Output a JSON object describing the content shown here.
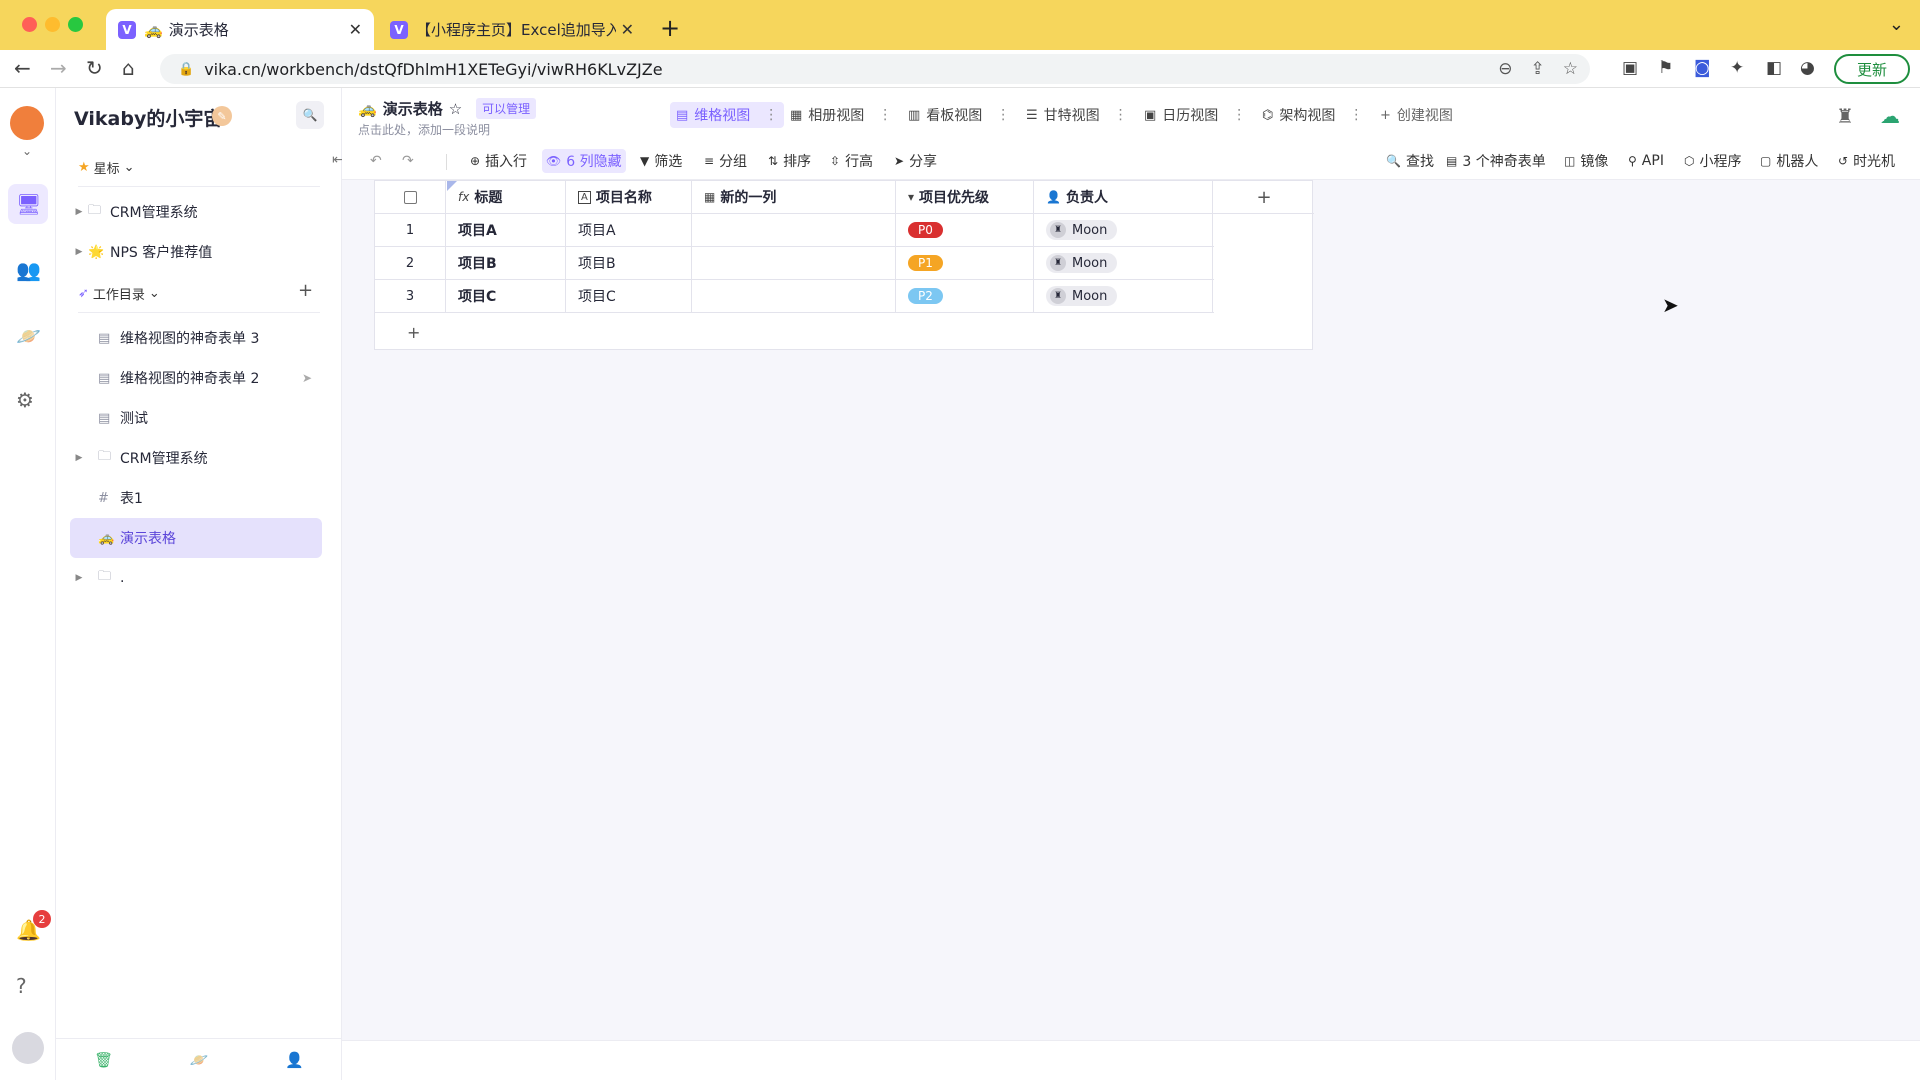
{
  "browser": {
    "tabs": [
      {
        "favicon": "V",
        "emoji": "🚕",
        "title": "演示表格",
        "active": true
      },
      {
        "favicon": "V",
        "title": "【小程序主页】Excel追加导入 -",
        "active": false
      }
    ],
    "url": "vika.cn/workbench/dstQfDhlmH1XETeGyi/viwRH6KLvZJZe",
    "update_label": "更新"
  },
  "space": {
    "name": "Vikaby的小宇宙",
    "starred_label": "星标",
    "starred_items": [
      {
        "label": "CRM管理系统",
        "icon": "folder-icon",
        "emoji": ""
      },
      {
        "label": "NPS 客户推荐值",
        "icon": "star-emoji-icon",
        "emoji": "🌟"
      }
    ],
    "workdir_label": "工作目录",
    "tree": [
      {
        "label": "维格视图的神奇表单 3",
        "icon": "form-icon",
        "has_arrow": false,
        "active": false,
        "send": false
      },
      {
        "label": "维格视图的神奇表单 2",
        "icon": "form-icon",
        "has_arrow": false,
        "active": false,
        "send": true
      },
      {
        "label": "测试",
        "icon": "form-icon",
        "has_arrow": false,
        "active": false,
        "send": false
      },
      {
        "label": "CRM管理系统",
        "icon": "folder-icon",
        "has_arrow": true,
        "active": false,
        "send": false
      },
      {
        "label": "表1",
        "icon": "datasheet-icon",
        "has_arrow": false,
        "active": false,
        "send": false
      },
      {
        "label": "演示表格",
        "icon": "taxi-emoji-icon",
        "has_arrow": false,
        "active": true,
        "send": false
      },
      {
        "label": ".",
        "icon": "folder-icon",
        "has_arrow": true,
        "active": false,
        "send": false
      }
    ],
    "notification_count": "2"
  },
  "datasheet": {
    "title": "演示表格",
    "permission": "可以管理",
    "description": "点击此处，添加一段说明",
    "views": [
      {
        "label": "维格视图",
        "icon": "grid-view-icon",
        "active": true
      },
      {
        "label": "相册视图",
        "icon": "gallery-view-icon",
        "active": false
      },
      {
        "label": "看板视图",
        "icon": "kanban-view-icon",
        "active": false
      },
      {
        "label": "甘特视图",
        "icon": "gantt-view-icon",
        "active": false
      },
      {
        "label": "日历视图",
        "icon": "calendar-view-icon",
        "active": false
      },
      {
        "label": "架构视图",
        "icon": "architecture-view-icon",
        "active": false
      }
    ],
    "create_view_label": "创建视图"
  },
  "toolbar": {
    "insert_row": "插入行",
    "hidden_cols": "6 列隐藏",
    "filter": "筛选",
    "group": "分组",
    "sort": "排序",
    "row_height": "行高",
    "share": "分享",
    "find": "查找",
    "forms": "3 个神奇表单",
    "mirror": "镜像",
    "api": "API",
    "widget": "小程序",
    "robot": "机器人",
    "timemachine": "时光机"
  },
  "grid": {
    "columns": [
      {
        "label": "标题",
        "icon": "formula-icon",
        "glyph": "fx"
      },
      {
        "label": "项目名称",
        "icon": "text-field-icon",
        "glyph": "A"
      },
      {
        "label": "新的一列",
        "icon": "date-field-icon",
        "glyph": "▦"
      },
      {
        "label": "项目优先级",
        "icon": "single-select-icon",
        "glyph": "▾"
      },
      {
        "label": "负责人",
        "icon": "member-field-icon",
        "glyph": "👤"
      }
    ],
    "rows": [
      {
        "num": "1",
        "title": "项目A",
        "name": "项目A",
        "newcol": "",
        "priority": "P0",
        "priority_color": "#d93030",
        "owner": "Moon"
      },
      {
        "num": "2",
        "title": "项目B",
        "name": "项目B",
        "newcol": "",
        "priority": "P1",
        "priority_color": "#f5a524",
        "owner": "Moon"
      },
      {
        "num": "3",
        "title": "项目C",
        "name": "项目C",
        "newcol": "",
        "priority": "P2",
        "priority_color": "#7cc7f2",
        "owner": "Moon"
      }
    ]
  },
  "colors": {
    "accent": "#7b61ff",
    "chrome": "#f6d65c",
    "sidebar_active": "#e5e1fc"
  }
}
